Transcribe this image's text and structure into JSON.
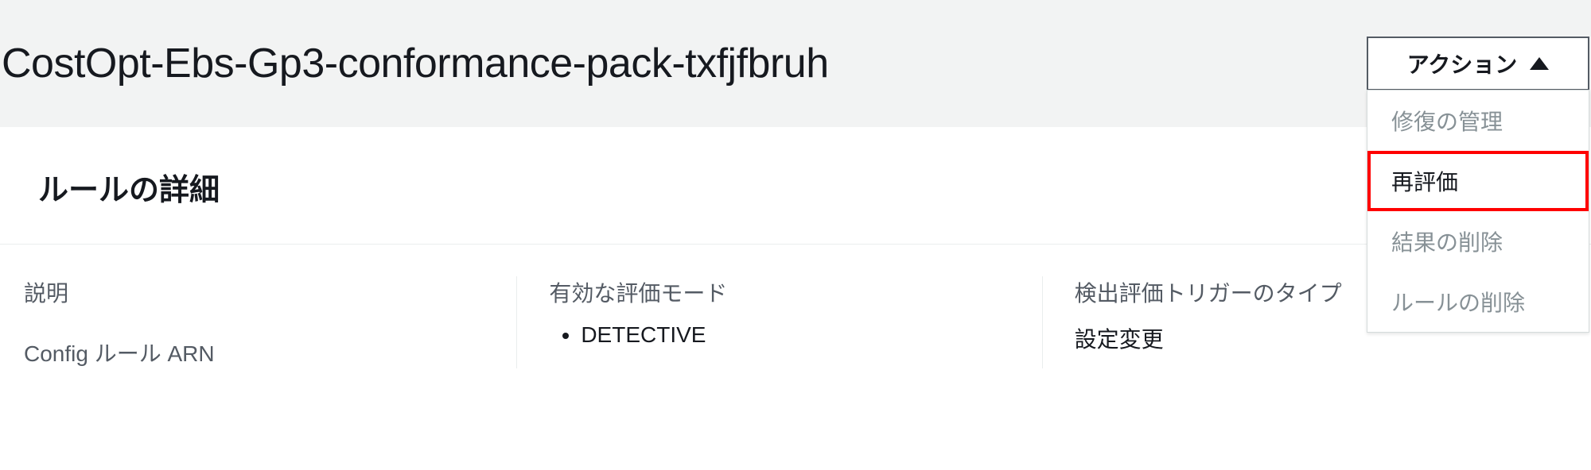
{
  "header": {
    "title": "CostOpt-Ebs-Gp3-conformance-pack-txfjfbruh",
    "actions_label": "アクション"
  },
  "dropdown": {
    "items": [
      {
        "label": "修復の管理",
        "enabled": false,
        "highlighted": false
      },
      {
        "label": "再評価",
        "enabled": true,
        "highlighted": true
      },
      {
        "label": "結果の削除",
        "enabled": false,
        "highlighted": false
      },
      {
        "label": "ルールの削除",
        "enabled": false,
        "highlighted": false
      }
    ]
  },
  "details": {
    "section_title": "ルールの詳細",
    "col1": {
      "description_label": "説明",
      "arn_label": "Config ルール ARN"
    },
    "col2": {
      "mode_label": "有効な評価モード",
      "mode_value": "DETECTIVE"
    },
    "col3": {
      "trigger_label": "検出評価トリガーのタイプ",
      "trigger_value": "設定変更"
    }
  }
}
